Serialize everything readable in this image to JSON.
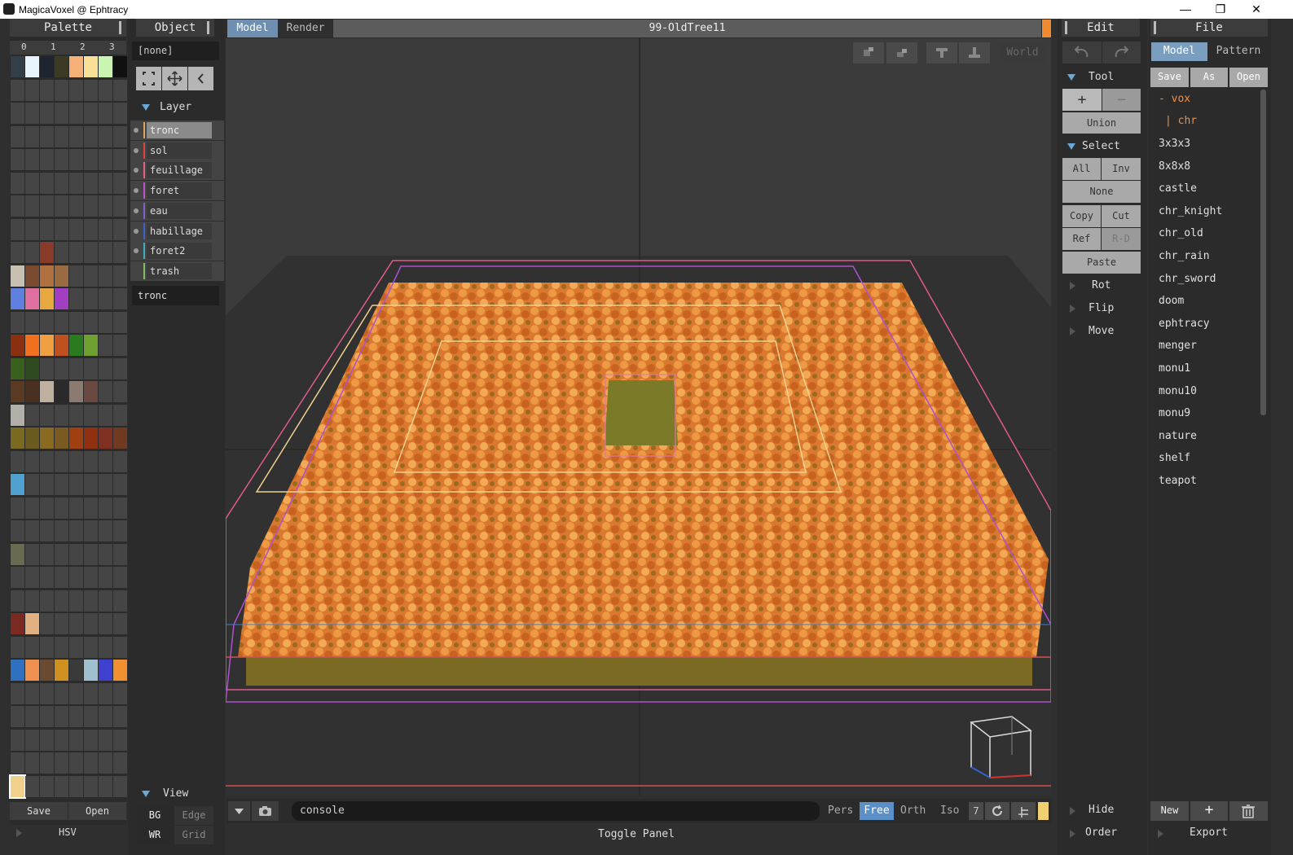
{
  "window": {
    "title": "MagicaVoxel @ Ephtracy",
    "min": "—",
    "restore": "❐",
    "close": "✕"
  },
  "palette": {
    "title": "Palette",
    "pages": [
      "0",
      "1",
      "2",
      "3"
    ],
    "save": "Save",
    "open": "Open",
    "hsv": "HSV"
  },
  "object": {
    "title": "Object",
    "name_field": "[none]",
    "layer_title": "Layer",
    "layers": [
      {
        "name": "tronc",
        "color": "#e0a060"
      },
      {
        "name": "sol",
        "color": "#e04040"
      },
      {
        "name": "feuillage",
        "color": "#e86080"
      },
      {
        "name": "foret",
        "color": "#c050d0"
      },
      {
        "name": "eau",
        "color": "#8060d0"
      },
      {
        "name": "habillage",
        "color": "#4060d0"
      },
      {
        "name": "foret2",
        "color": "#40b0c0"
      },
      {
        "name": "trash",
        "color": "#80c060"
      }
    ],
    "layer_name_field": "tronc",
    "view_title": "View",
    "view_bg": "BG",
    "view_edge": "Edge",
    "view_wr": "WR",
    "view_grid": "Grid"
  },
  "main": {
    "tabs": [
      "Model",
      "Render"
    ],
    "active_tab": "Model",
    "doc_title": "99-OldTree11",
    "world": "World",
    "console_placeholder": "console",
    "proj": [
      "Pers",
      "Free",
      "Orth",
      "Iso"
    ],
    "active_proj": "Free",
    "step": "7",
    "toggle_panel": "Toggle Panel",
    "accent": "#f08a30"
  },
  "edit": {
    "title": "Edit",
    "tool_title": "Tool",
    "plus": "+",
    "minus": "−",
    "union": "Union",
    "select_title": "Select",
    "all": "All",
    "inv": "Inv",
    "none": "None",
    "copy": "Copy",
    "cut": "Cut",
    "ref": "Ref",
    "rd": "R-D",
    "paste": "Paste",
    "rot": "Rot",
    "flip": "Flip",
    "move": "Move",
    "hide": "Hide",
    "order": "Order"
  },
  "file": {
    "title": "File",
    "tab_model": "Model",
    "tab_pattern": "Pattern",
    "save": "Save",
    "as": "As",
    "open": "Open",
    "folder_vox": "- vox",
    "folder_chr": "| chr",
    "items": [
      "3x3x3",
      "8x8x8",
      "castle",
      "chr_knight",
      "chr_old",
      "chr_rain",
      "chr_sword",
      "doom",
      "ephtracy",
      "menger",
      "monu1",
      "monu10",
      "monu9",
      "nature",
      "shelf",
      "teapot"
    ],
    "new": "New",
    "add": "+",
    "export": "Export"
  }
}
